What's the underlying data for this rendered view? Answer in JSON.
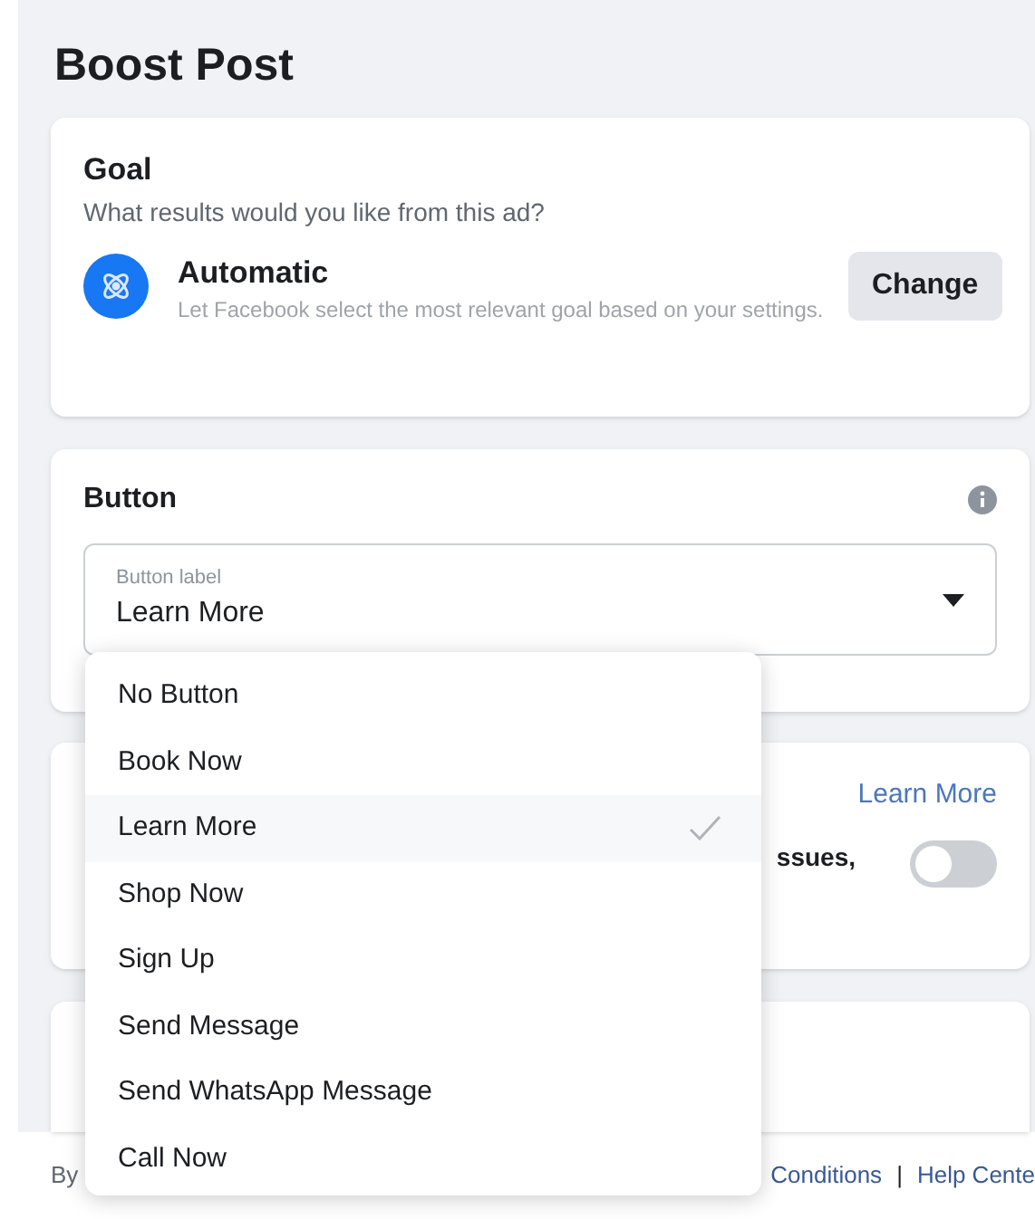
{
  "title": "Boost Post",
  "goal": {
    "heading": "Goal",
    "question": "What results would you like from this ad?",
    "option_title": "Automatic",
    "option_description": "Let Facebook select the most relevant goal based on your settings.",
    "change_button": "Change"
  },
  "button_section": {
    "heading": "Button",
    "field_label": "Button label",
    "field_value": "Learn More"
  },
  "third_card": {
    "link": "Learn More",
    "text_fragment": "ssues,",
    "toggle_on": false
  },
  "footer": {
    "left": "By",
    "links": [
      "Conditions",
      "Help Cente"
    ],
    "separator": "|"
  },
  "menu": [
    {
      "label": "No Button",
      "selected": false
    },
    {
      "label": "Book Now",
      "selected": false
    },
    {
      "label": "Learn More",
      "selected": true
    },
    {
      "label": "Shop Now",
      "selected": false
    },
    {
      "label": "Sign Up",
      "selected": false
    },
    {
      "label": "Send Message",
      "selected": false
    },
    {
      "label": "Send WhatsApp Message",
      "selected": false
    },
    {
      "label": "Call Now",
      "selected": false
    }
  ]
}
